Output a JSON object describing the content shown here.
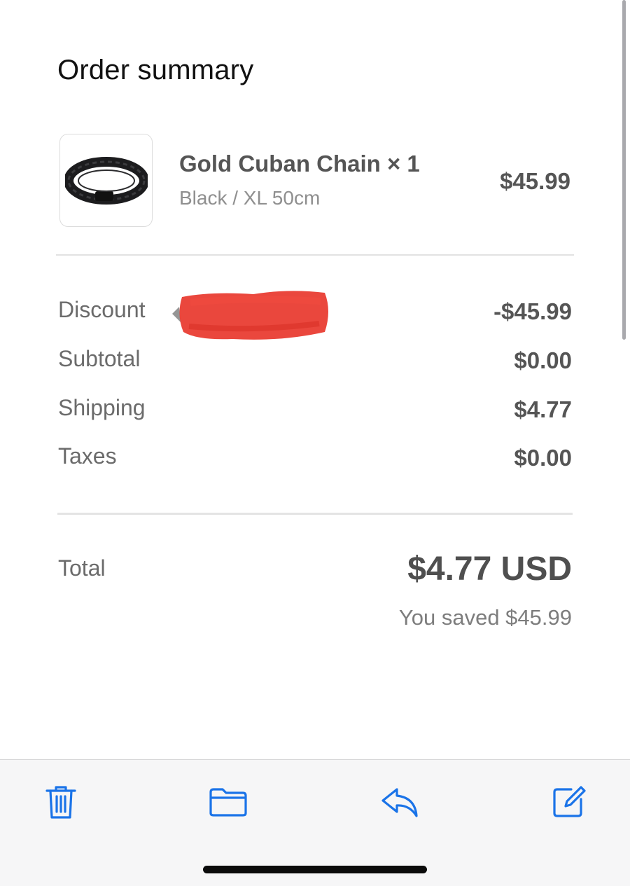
{
  "order_summary": {
    "title": "Order summary",
    "item": {
      "name": "Gold Cuban Chain × 1",
      "variant": "Black / XL 50cm",
      "price": "$45.99"
    },
    "lines": {
      "discount": {
        "label": "Discount",
        "value": "-$45.99"
      },
      "subtotal": {
        "label": "Subtotal",
        "value": "$0.00"
      },
      "shipping": {
        "label": "Shipping",
        "value": "$4.77"
      },
      "taxes": {
        "label": "Taxes",
        "value": "$0.00"
      }
    },
    "total": {
      "label": "Total",
      "value": "$4.77 USD",
      "saved": "You saved $45.99"
    }
  },
  "toolbar": {
    "items": [
      "trash-icon",
      "folder-icon",
      "reply-icon",
      "compose-icon"
    ],
    "icon_color": "#1a73e8"
  },
  "colors": {
    "redaction": "#e8372c"
  }
}
